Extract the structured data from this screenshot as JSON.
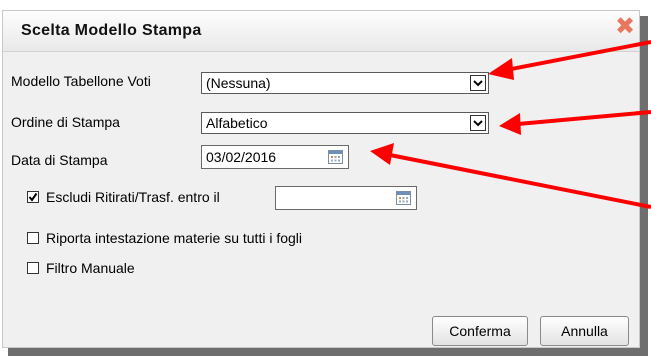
{
  "dialog": {
    "title": "Scelta Modello Stampa",
    "close_icon": "close-icon"
  },
  "form": {
    "modello_label": "Modello Tabellone Voti",
    "modello_value": "(Nessuna)",
    "ordine_label": "Ordine di Stampa",
    "ordine_value": "Alfabetico",
    "data_label": "Data di Stampa",
    "data_value": "03/02/2016",
    "escludi_label": "Escludi Ritirati/Trasf. entro il",
    "escludi_checked": true,
    "escludi_date_value": "",
    "riporta_label": "Riporta intestazione materie su tutti i fogli",
    "riporta_checked": false,
    "filtro_label": "Filtro Manuale",
    "filtro_checked": false
  },
  "buttons": {
    "confirm_label": "Conferma",
    "cancel_label": "Annulla"
  },
  "colors": {
    "annotation_arrow": "#ff0000",
    "close_icon": "#e8775e"
  }
}
